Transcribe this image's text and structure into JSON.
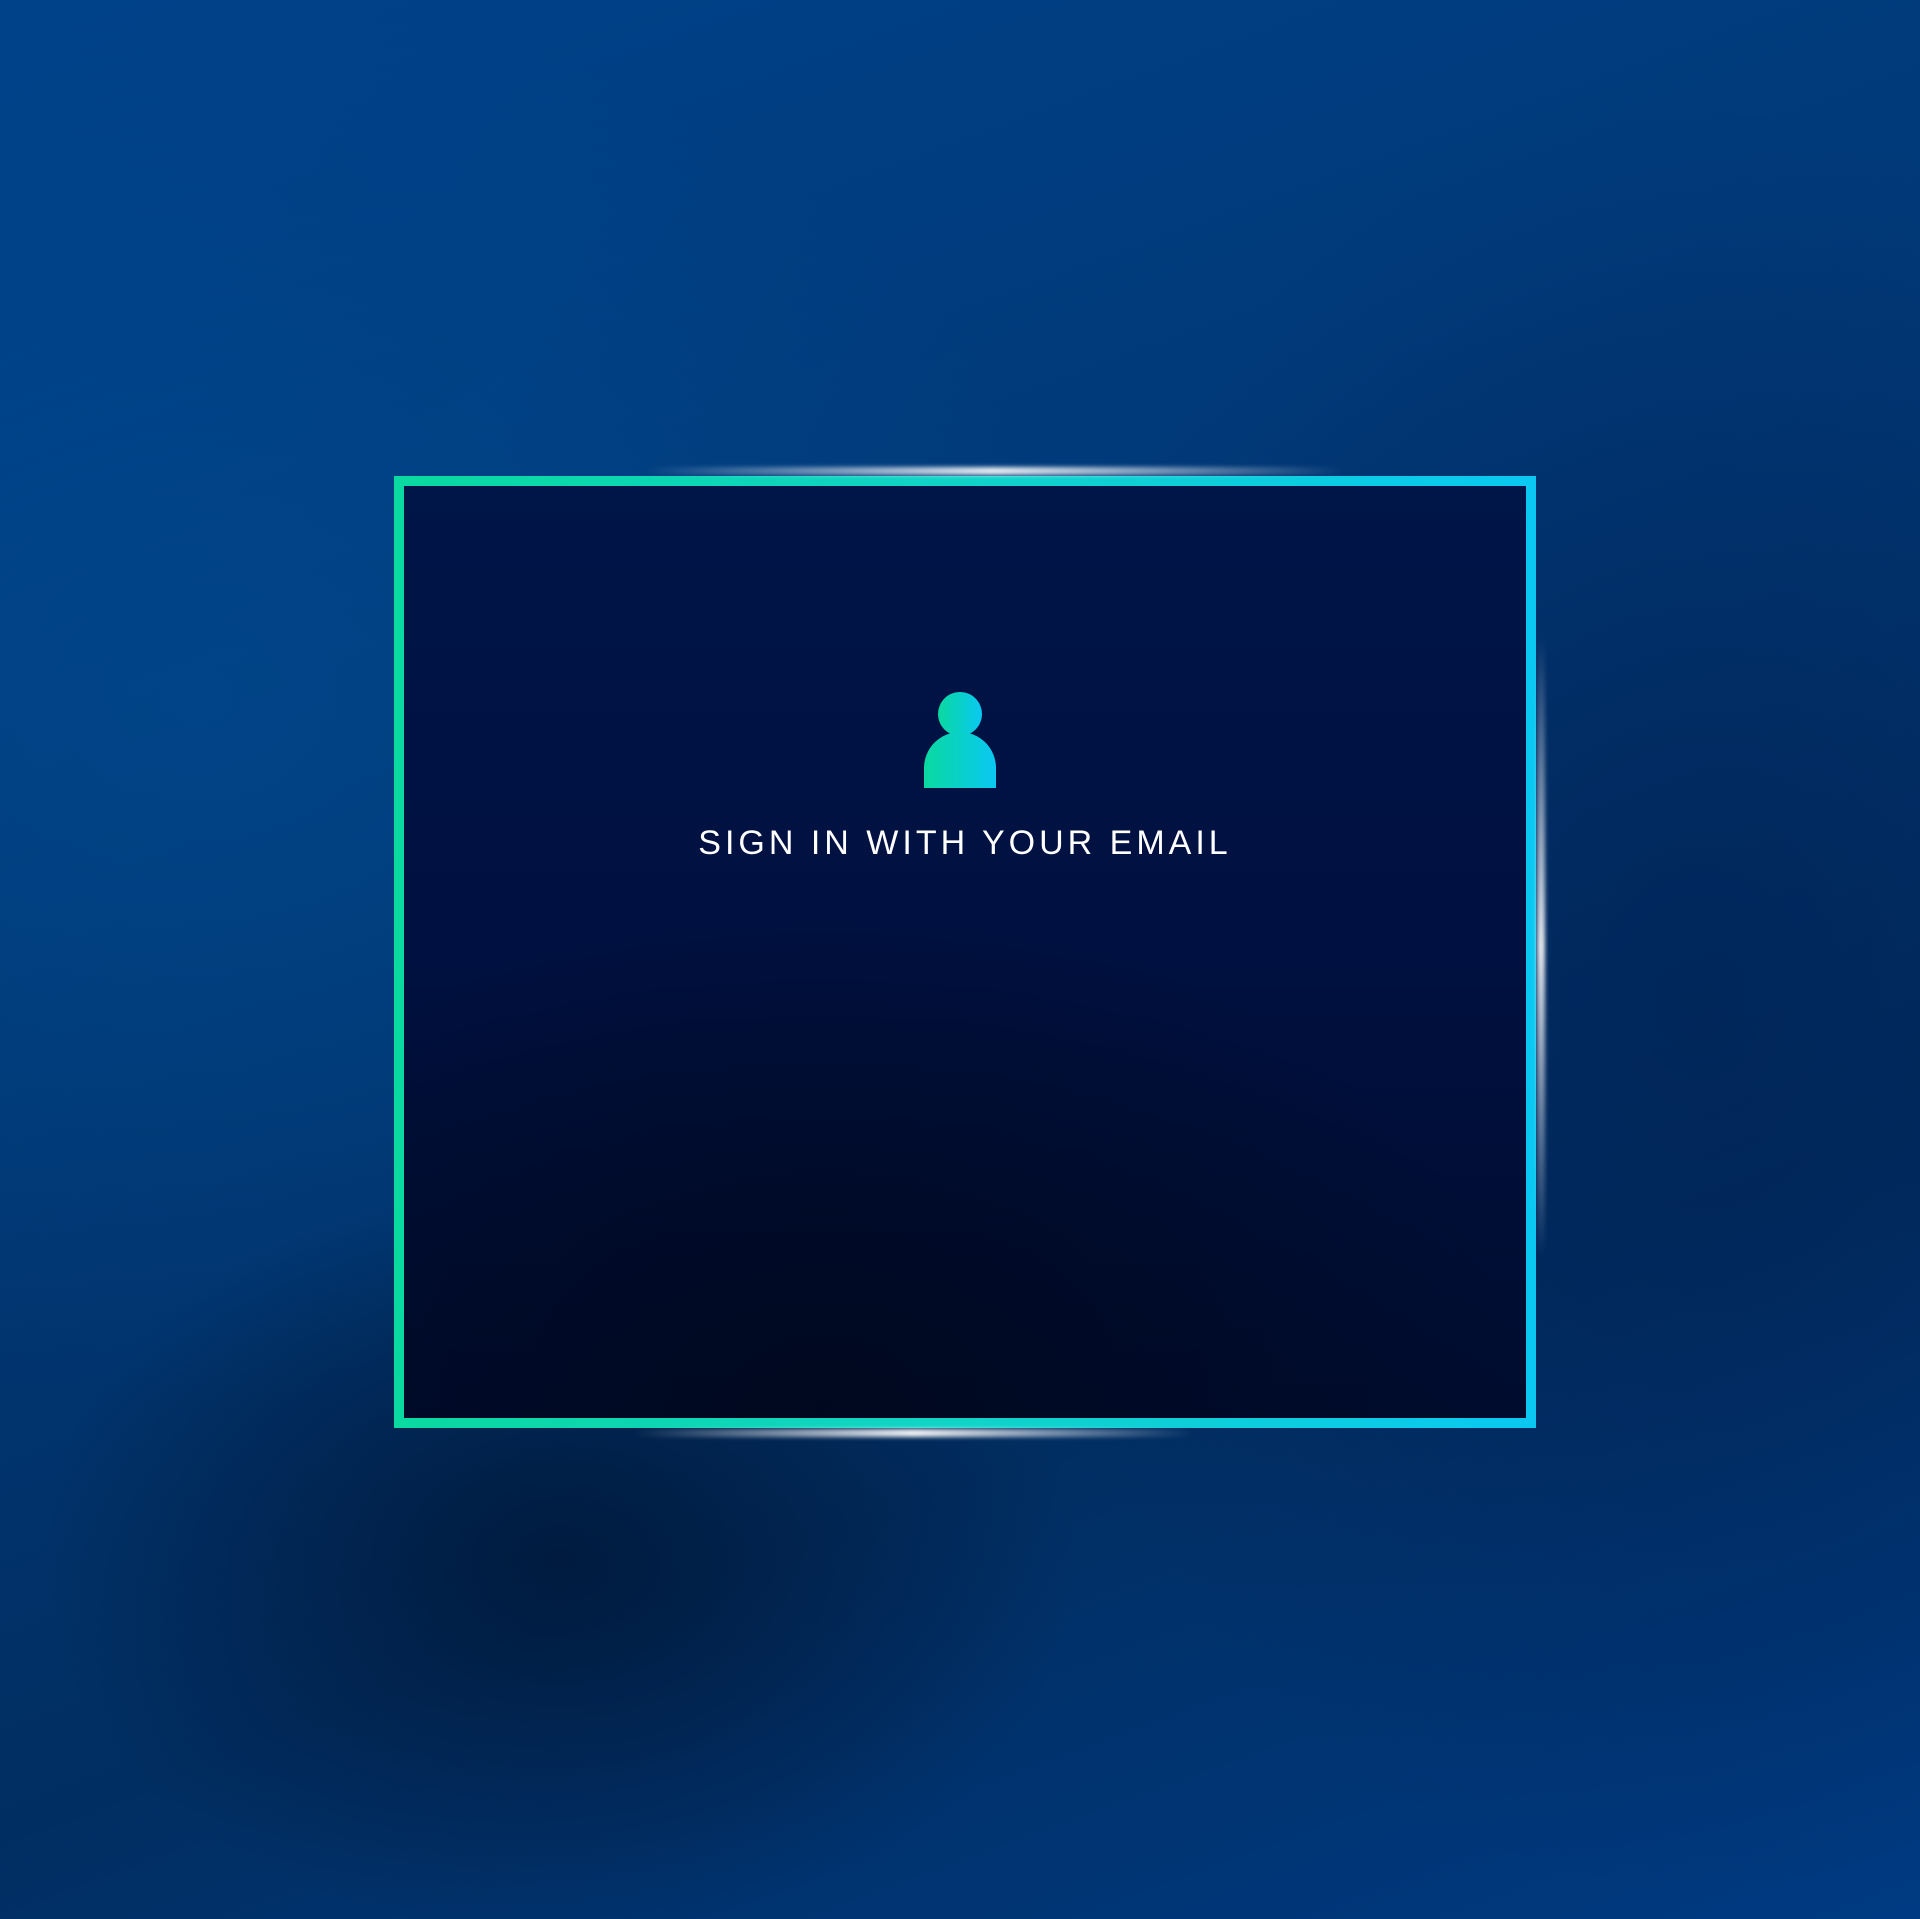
{
  "signin": {
    "icon": "user-icon",
    "heading": "SIGN IN WITH YOUR EMAIL"
  },
  "colors": {
    "border_start": "#0ad9a0",
    "border_end": "#0ac8f2",
    "panel_bg": "#001040",
    "page_bg": "#013876",
    "text": "#ffffff"
  }
}
